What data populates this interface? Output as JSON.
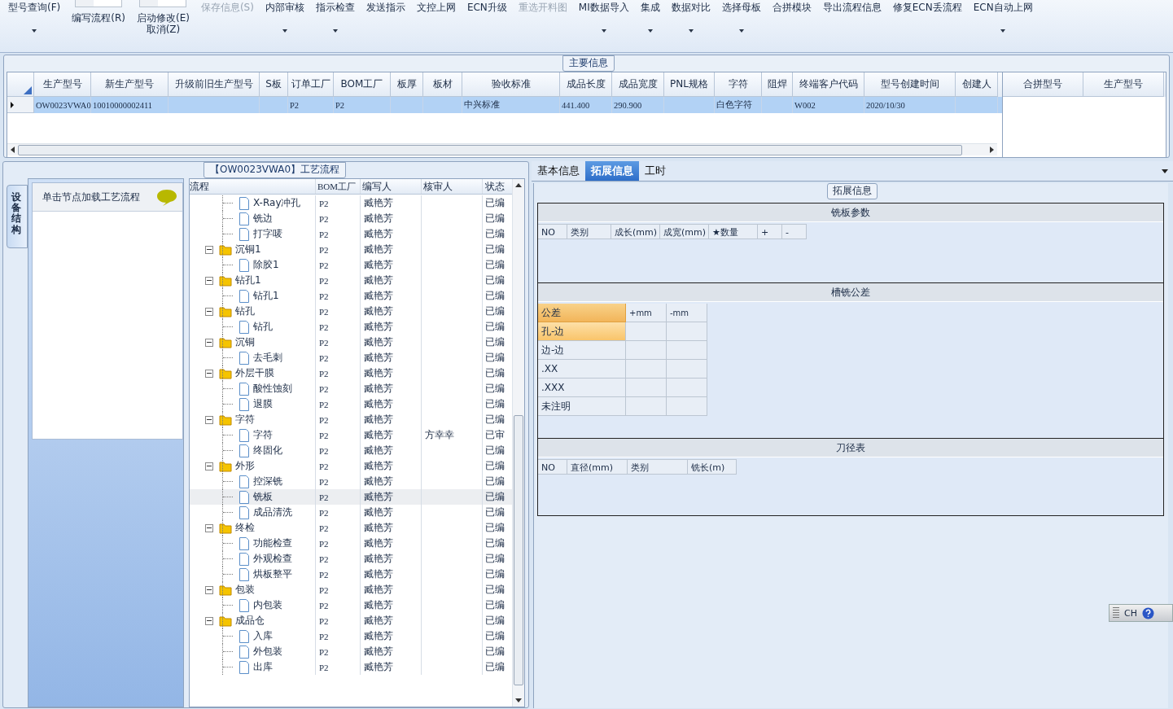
{
  "toolbar": [
    {
      "kind": "button",
      "lines": [
        "型号查询(F)"
      ],
      "dropdown": true,
      "disabled": false
    },
    {
      "kind": "toggle",
      "lines": [
        "编写流程(R)"
      ],
      "dropdown": false,
      "disabled": false
    },
    {
      "kind": "toggle",
      "lines": [
        "启动修改(E)",
        "取消(Z)"
      ],
      "dropdown": false,
      "disabled": false
    },
    {
      "kind": "button",
      "lines": [
        "保存信息(S)"
      ],
      "dropdown": false,
      "disabled": true
    },
    {
      "kind": "button",
      "lines": [
        "内部审核"
      ],
      "dropdown": true,
      "disabled": false
    },
    {
      "kind": "button",
      "lines": [
        "指示检查"
      ],
      "dropdown": true,
      "disabled": false
    },
    {
      "kind": "button",
      "lines": [
        "发送指示"
      ],
      "dropdown": false,
      "disabled": false
    },
    {
      "kind": "button",
      "lines": [
        "文控上网"
      ],
      "dropdown": false,
      "disabled": false
    },
    {
      "kind": "button",
      "lines": [
        "ECN升级"
      ],
      "dropdown": false,
      "disabled": false
    },
    {
      "kind": "button",
      "lines": [
        "重选开料图"
      ],
      "dropdown": false,
      "disabled": true
    },
    {
      "kind": "button",
      "lines": [
        "MI数据导入"
      ],
      "dropdown": true,
      "disabled": false
    },
    {
      "kind": "button",
      "lines": [
        "集成"
      ],
      "dropdown": true,
      "disabled": false
    },
    {
      "kind": "button",
      "lines": [
        "数据对比"
      ],
      "dropdown": true,
      "disabled": false
    },
    {
      "kind": "button",
      "lines": [
        "选择母板"
      ],
      "dropdown": true,
      "disabled": false
    },
    {
      "kind": "button",
      "lines": [
        "合拼模块"
      ],
      "dropdown": false,
      "disabled": false
    },
    {
      "kind": "button",
      "lines": [
        "导出流程信息"
      ],
      "dropdown": false,
      "disabled": false
    },
    {
      "kind": "button",
      "lines": [
        "修复ECN丢流程"
      ],
      "dropdown": false,
      "disabled": false
    },
    {
      "kind": "button",
      "lines": [
        "ECN自动上网"
      ],
      "dropdown": true,
      "disabled": false
    }
  ],
  "main_info": {
    "title": "主要信息",
    "columns": [
      "生产型号",
      "新生产型号",
      "升级前旧生产型号",
      "S板",
      "订单工厂",
      "BOM工厂",
      "板厚",
      "板材",
      "验收标准",
      "成品长度",
      "成品宽度",
      "PNL规格",
      "字符",
      "阻焊",
      "终端客户代码",
      "型号创建时间",
      "创建人"
    ],
    "rows": [
      {
        "selected": true,
        "cells": [
          "OW0023VWA0",
          "10010000002411",
          null,
          null,
          "P2",
          "P2",
          null,
          null,
          "中兴标准",
          "441.400",
          "290.900",
          null,
          "白色字符",
          null,
          "W002",
          "2020/10/30",
          null
        ]
      }
    ]
  },
  "merge_table": {
    "columns": [
      "合拼型号",
      "生产型号"
    ]
  },
  "process": {
    "title": "【OW0023VWA0】工艺流程",
    "side_tab": "设备结构",
    "hint": "单击节点加载工艺流程",
    "columns": [
      "流程",
      "BOM工厂",
      "编写人",
      "核审人",
      "状态"
    ],
    "nodes": [
      {
        "kind": "step",
        "name": "X-Ray冲孔",
        "bom": "P2",
        "writer": "臧艳芳",
        "status": "已编",
        "selected": false
      },
      {
        "kind": "step",
        "name": "铣边",
        "bom": "P2",
        "writer": "臧艳芳",
        "status": "已编",
        "selected": false
      },
      {
        "kind": "step",
        "name": "打字唛",
        "bom": "P2",
        "writer": "臧艳芳",
        "status": "已编",
        "selected": false
      },
      {
        "kind": "folder",
        "name": "沉铜1",
        "bom": "P2",
        "writer": "臧艳芳",
        "status": "已编",
        "selected": false,
        "expanded": true,
        "children": [
          {
            "kind": "step",
            "name": "除胶1",
            "bom": "P2",
            "writer": "臧艳芳",
            "status": "已编",
            "selected": false
          }
        ]
      },
      {
        "kind": "folder",
        "name": "钻孔1",
        "bom": "P2",
        "writer": "臧艳芳",
        "status": "已编",
        "selected": false,
        "expanded": true,
        "children": [
          {
            "kind": "step",
            "name": "钻孔1",
            "bom": "P2",
            "writer": "臧艳芳",
            "status": "已编",
            "selected": false
          }
        ]
      },
      {
        "kind": "folder",
        "name": "钻孔",
        "bom": "P2",
        "writer": "臧艳芳",
        "status": "已编",
        "selected": false,
        "expanded": true,
        "children": [
          {
            "kind": "step",
            "name": "钻孔",
            "bom": "P2",
            "writer": "臧艳芳",
            "status": "已编",
            "selected": false
          }
        ]
      },
      {
        "kind": "folder",
        "name": "沉铜",
        "bom": "P2",
        "writer": "臧艳芳",
        "status": "已编",
        "selected": false,
        "expanded": true,
        "children": [
          {
            "kind": "step",
            "name": "去毛刺",
            "bom": "P2",
            "writer": "臧艳芳",
            "status": "已编",
            "selected": false
          }
        ]
      },
      {
        "kind": "folder",
        "name": "外层干膜",
        "bom": "P2",
        "writer": "臧艳芳",
        "status": "已编",
        "selected": false,
        "expanded": true,
        "children": [
          {
            "kind": "step",
            "name": "酸性蚀刻",
            "bom": "P2",
            "writer": "臧艳芳",
            "status": "已编",
            "selected": false
          },
          {
            "kind": "step",
            "name": "退膜",
            "bom": "P2",
            "writer": "臧艳芳",
            "status": "已编",
            "selected": false
          }
        ]
      },
      {
        "kind": "folder",
        "name": "字符",
        "bom": "P2",
        "writer": "臧艳芳",
        "status": "已编",
        "selected": false,
        "expanded": true,
        "children": [
          {
            "kind": "step",
            "name": "字符",
            "bom": "P2",
            "writer": "臧艳芳",
            "reviewer": "方幸幸",
            "status": "已审",
            "selected": false
          },
          {
            "kind": "step",
            "name": "终固化",
            "bom": "P2",
            "writer": "臧艳芳",
            "status": "已编",
            "selected": false
          }
        ]
      },
      {
        "kind": "folder",
        "name": "外形",
        "bom": "P2",
        "writer": "臧艳芳",
        "status": "已编",
        "selected": false,
        "expanded": true,
        "children": [
          {
            "kind": "step",
            "name": "控深铣",
            "bom": "P2",
            "writer": "臧艳芳",
            "status": "已编",
            "selected": false
          },
          {
            "kind": "step",
            "name": "铣板",
            "bom": "P2",
            "writer": "臧艳芳",
            "status": "已编",
            "selected": true
          },
          {
            "kind": "step",
            "name": "成品清洗",
            "bom": "P2",
            "writer": "臧艳芳",
            "status": "已编",
            "selected": false
          }
        ]
      },
      {
        "kind": "folder",
        "name": "终检",
        "bom": "P2",
        "writer": "臧艳芳",
        "status": "已编",
        "selected": false,
        "expanded": true,
        "children": [
          {
            "kind": "step",
            "name": "功能检查",
            "bom": "P2",
            "writer": "臧艳芳",
            "status": "已编",
            "selected": false
          },
          {
            "kind": "step",
            "name": "外观检查",
            "bom": "P2",
            "writer": "臧艳芳",
            "status": "已编",
            "selected": false
          },
          {
            "kind": "step",
            "name": "烘板整平",
            "bom": "P2",
            "writer": "臧艳芳",
            "status": "已编",
            "selected": false
          }
        ]
      },
      {
        "kind": "folder",
        "name": "包装",
        "bom": "P2",
        "writer": "臧艳芳",
        "status": "已编",
        "selected": false,
        "expanded": true,
        "children": [
          {
            "kind": "step",
            "name": "内包装",
            "bom": "P2",
            "writer": "臧艳芳",
            "status": "已编",
            "selected": false
          }
        ]
      },
      {
        "kind": "folder",
        "name": "成品仓",
        "bom": "P2",
        "writer": "臧艳芳",
        "status": "已编",
        "selected": false,
        "expanded": true,
        "children": [
          {
            "kind": "step",
            "name": "入库",
            "bom": "P2",
            "writer": "臧艳芳",
            "status": "已编",
            "selected": false
          },
          {
            "kind": "step",
            "name": "外包装",
            "bom": "P2",
            "writer": "臧艳芳",
            "status": "已编",
            "selected": false
          },
          {
            "kind": "step",
            "name": "出库",
            "bom": "P2",
            "writer": "臧艳芳",
            "status": "已编",
            "selected": false
          }
        ]
      }
    ]
  },
  "detail": {
    "tabs": [
      {
        "label": "基本信息",
        "selected": false
      },
      {
        "label": "拓展信息",
        "selected": true
      },
      {
        "label": "工时",
        "selected": false
      }
    ],
    "group_title": "拓展信息",
    "mill_params": {
      "title": "铣板参数",
      "columns": [
        "NO",
        "类别",
        "成长(mm)",
        "成宽(mm)",
        "★数量",
        "+",
        "-"
      ]
    },
    "slot_tolerance": {
      "title": "槽铣公差",
      "columns": [
        "公差",
        "+mm",
        "-mm"
      ],
      "rows": [
        {
          "label": "孔-边",
          "selected": true
        },
        {
          "label": "边-边",
          "selected": false
        },
        {
          "label": ".XX",
          "selected": false
        },
        {
          "label": ".XXX",
          "selected": false
        },
        {
          "label": "未注明",
          "selected": false
        }
      ]
    },
    "cutter_table": {
      "title": "刀径表",
      "columns": [
        "NO",
        "直径(mm)",
        "类别",
        "铣长(m)"
      ]
    }
  },
  "language_bar": {
    "language": "CH"
  }
}
